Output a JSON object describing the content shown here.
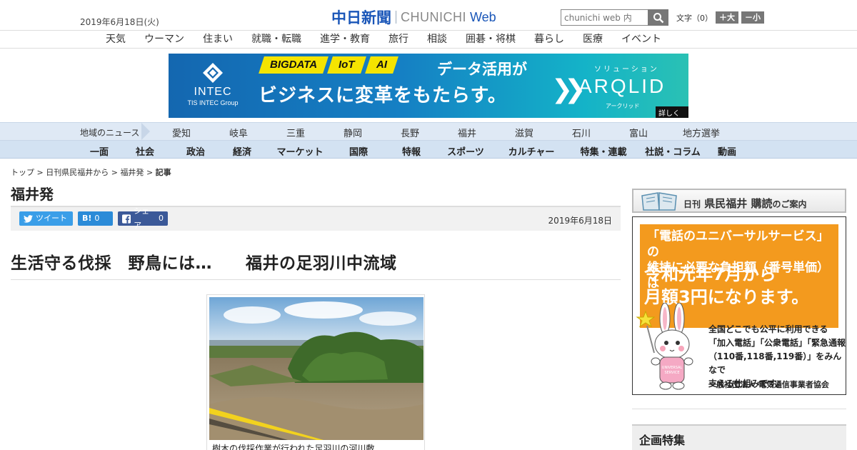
{
  "header": {
    "date": "2019年6月18日(火)",
    "logo_jp": "中日新聞",
    "logo_en": "CHUNICHI",
    "logo_web": "Web",
    "search_placeholder": "chunichi web 内",
    "fontsize_label": "文字（0）",
    "font_larger": "＋大",
    "font_smaller": "－小"
  },
  "menu": [
    "天気",
    "ウーマン",
    "住まい",
    "就職・転職",
    "進学・教育",
    "旅行",
    "相談",
    "囲碁・将棋",
    "暮らし",
    "医療",
    "イベント"
  ],
  "banner": {
    "company": "INTEC",
    "company_sub": "TIS INTEC Group",
    "tags": [
      "BIGDATA",
      "IoT",
      "AI"
    ],
    "line1": "データ活用が",
    "line2": "ビジネスに変革をもたらす。",
    "solution_label": "ソリューション",
    "product": "ARQLID",
    "product_kana": "アークリッド",
    "details": "詳しくは"
  },
  "region_nav": {
    "label": "地域のニュース",
    "items": [
      "愛知",
      "岐阜",
      "三重",
      "静岡",
      "長野",
      "福井",
      "滋賀",
      "石川",
      "富山",
      "地方選挙"
    ]
  },
  "category_nav": [
    "一面",
    "社会",
    "政治",
    "経済",
    "マーケット",
    "国際",
    "特報",
    "スポーツ",
    "カルチャー",
    "特集・連載",
    "社説・コラム",
    "動画"
  ],
  "breadcrumb": {
    "top": "トップ",
    "sep": ">",
    "level1": "日刊県民福井から",
    "level2": "福井発",
    "current": "記事"
  },
  "section_title": "福井発",
  "social": {
    "tweet": "ツイート",
    "hatena": "B!",
    "hatena_count": "0",
    "share": "シェア",
    "share_count": "0"
  },
  "article": {
    "date": "2019年6月18日",
    "headline": "生活守る伐採　野鳥には…　　福井の足羽川中流域",
    "caption": "樹木の伐採作業が行われた足羽川の河川敷"
  },
  "sidebar": {
    "subscribe_prefix": "日刊",
    "subscribe_name": "県民福井",
    "subscribe_text": "購読",
    "subscribe_suffix": "のご案内",
    "ad_line1": "「電話のユニバーサルサービス」の",
    "ad_line2": "維持に必要な負担額（番号単価）は",
    "ad_big1": "令和元年7月から",
    "ad_big2": "月額3円になります。",
    "ad_body1": "全国どこでも公平に利用できる",
    "ad_body2": "「加入電話」「公衆電話」「緊急通報",
    "ad_body3": "（110番,118番,119番）」をみんなで",
    "ad_body4": "支える仕組みです。",
    "ad_org": "一般社団法人 電気通信事業者協会",
    "feature_title": "企画特集"
  },
  "colors": {
    "brand_blue": "#1a56b8",
    "region_bg": "#dfe9f5",
    "category_bg": "#d3e2f2",
    "ad_orange": "#f39a1e",
    "twitter": "#3a9ee8",
    "hatena": "#2b8bd8",
    "facebook": "#3b5998"
  }
}
